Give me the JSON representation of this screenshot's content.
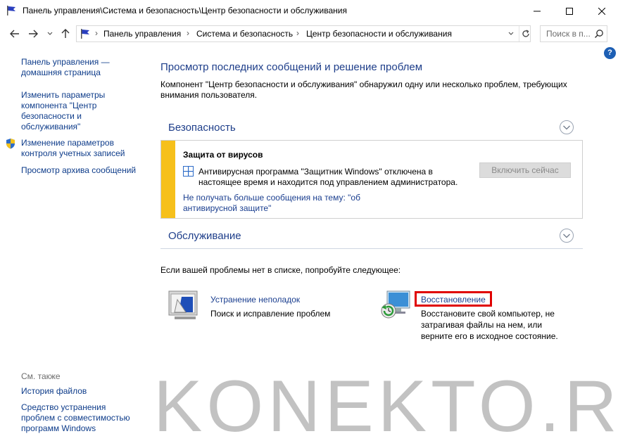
{
  "window": {
    "title": "Панель управления\\Система и безопасность\\Центр безопасности и обслуживания"
  },
  "address": {
    "crumbs": [
      "Панель управления",
      "Система и безопасность",
      "Центр безопасности и обслуживания"
    ],
    "search_placeholder": "Поиск в п..."
  },
  "left": {
    "home": "Панель управления —\nдомашняя страница",
    "change_settings": "Изменить параметры\nкомпонента \"Центр\nбезопасности и\nобслуживания\"",
    "uac": "Изменение параметров\nконтроля учетных записей",
    "archive": "Просмотр архива сообщений",
    "see_also": "См. также",
    "file_history": "История файлов",
    "compat": "Средство устранения\nпроблем с совместимостью\nпрограмм Windows"
  },
  "main": {
    "title": "Просмотр последних сообщений и решение проблем",
    "description": "Компонент \"Центр безопасности и обслуживания\" обнаружил одну или несколько проблем, требующих\nвнимания пользователя.",
    "security": {
      "label": "Безопасность",
      "alert_title": "Защита от вирусов",
      "alert_text": "Антивирусная программа \"Защитник Windows\" отключена в\nнастоящее время и находится под управлением администратора.",
      "alert_link": "Не получать больше сообщения на тему: \"об\nантивирусной защите\"",
      "button": "Включить сейчас"
    },
    "maintenance": {
      "label": "Обслуживание"
    },
    "try_text": "Если вашей проблемы нет в списке, попробуйте следующее:",
    "tools": [
      {
        "link": "Устранение неполадок",
        "desc": "Поиск и исправление проблем"
      },
      {
        "link": "Восстановление",
        "desc": "Восстановите свой компьютер, не\nзатрагивая файлы на нем, или\nверните его в исходное состояние."
      }
    ]
  },
  "watermark": "KONEKTO.RU",
  "colors": {
    "accent": "#1e3e8a",
    "alert_stripe": "#f6c01b",
    "highlight": "#e00000"
  }
}
